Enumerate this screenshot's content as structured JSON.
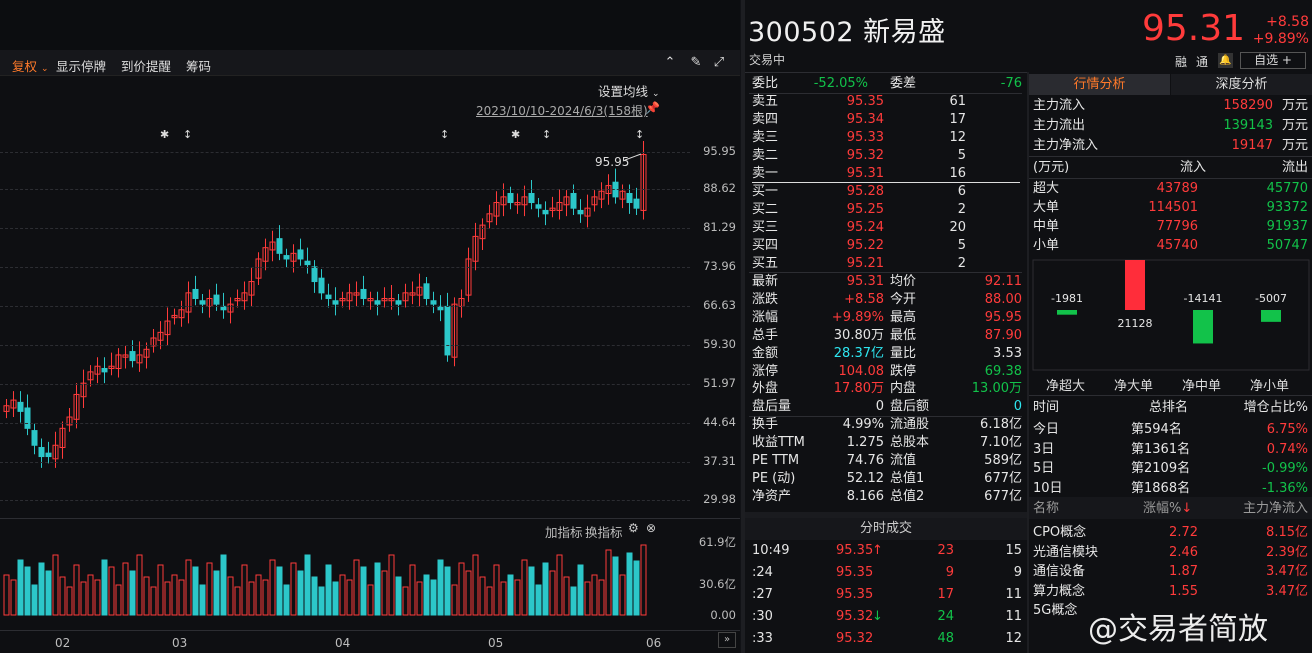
{
  "stock": {
    "code": "300502",
    "name": "新易盛",
    "status": "交易中",
    "price": "95.31",
    "change": "+8.58",
    "change_pct": "+9.89%",
    "btn_rong": "融",
    "btn_tong": "通",
    "btn_watch": "自选 +"
  },
  "toolbar": {
    "fq": "复权",
    "show_halt": "显示停牌",
    "alert": "到价提醒",
    "chips": "筹码",
    "set_ma": "设置均线",
    "range": "2023/10/10-2024/6/3(158根)",
    "peak_label": "95.95"
  },
  "y_labels": [
    "95.95",
    "88.62",
    "81.29",
    "73.96",
    "66.63",
    "59.30",
    "51.97",
    "44.64",
    "37.31",
    "29.98"
  ],
  "x_labels": [
    "02",
    "03",
    "04",
    "05",
    "06"
  ],
  "vol": {
    "add_indicator": "加指标",
    "switch_indicator": "换指标",
    "labels": [
      "61.9亿",
      "30.6亿",
      "0.00"
    ]
  },
  "orderbook": {
    "weibi_label": "委比",
    "weibi": "-52.05%",
    "weicha_label": "委差",
    "weicha": "-76",
    "asks": [
      {
        "label": "卖五",
        "price": "95.35",
        "vol": "61"
      },
      {
        "label": "卖四",
        "price": "95.34",
        "vol": "17"
      },
      {
        "label": "卖三",
        "price": "95.33",
        "vol": "12"
      },
      {
        "label": "卖二",
        "price": "95.32",
        "vol": "5"
      },
      {
        "label": "卖一",
        "price": "95.31",
        "vol": "16"
      }
    ],
    "bids": [
      {
        "label": "买一",
        "price": "95.28",
        "vol": "6"
      },
      {
        "label": "买二",
        "price": "95.25",
        "vol": "2"
      },
      {
        "label": "买三",
        "price": "95.24",
        "vol": "20"
      },
      {
        "label": "买四",
        "price": "95.22",
        "vol": "5"
      },
      {
        "label": "买五",
        "price": "95.21",
        "vol": "2"
      }
    ]
  },
  "quote": [
    {
      "l1": "最新",
      "v1": "95.31",
      "c1": "red",
      "l2": "均价",
      "v2": "92.11",
      "c2": "red"
    },
    {
      "l1": "涨跌",
      "v1": "+8.58",
      "c1": "red",
      "l2": "今开",
      "v2": "88.00",
      "c2": "red"
    },
    {
      "l1": "涨幅",
      "v1": "+9.89%",
      "c1": "red",
      "l2": "最高",
      "v2": "95.95",
      "c2": "red"
    },
    {
      "l1": "总手",
      "v1": "30.80万",
      "c1": "white",
      "l2": "最低",
      "v2": "87.90",
      "c2": "red"
    },
    {
      "l1": "金额",
      "v1": "28.37亿",
      "c1": "cyan",
      "l2": "量比",
      "v2": "3.53",
      "c2": "white"
    },
    {
      "l1": "涨停",
      "v1": "104.08",
      "c1": "red",
      "l2": "跌停",
      "v2": "69.38",
      "c2": "green"
    },
    {
      "l1": "外盘",
      "v1": "17.80万",
      "c1": "red",
      "l2": "内盘",
      "v2": "13.00万",
      "c2": "green"
    },
    {
      "l1": "盘后量",
      "v1": "0",
      "c1": "white",
      "l2": "盘后额",
      "v2": "0",
      "c2": "cyan"
    },
    {
      "l1": "换手",
      "v1": "4.99%",
      "c1": "white",
      "l2": "流通股",
      "v2": "6.18亿",
      "c2": "white"
    },
    {
      "l1": "收益TTM",
      "v1": "1.275",
      "c1": "white",
      "l2": "总股本",
      "v2": "7.10亿",
      "c2": "white"
    },
    {
      "l1": "PE TTM",
      "v1": "74.76",
      "c1": "white",
      "l2": "流值",
      "v2": "589亿",
      "c2": "white"
    },
    {
      "l1": "PE (动)",
      "v1": "52.12",
      "c1": "white",
      "l2": "总值1",
      "v2": "677亿",
      "c2": "white"
    },
    {
      "l1": "净资产",
      "v1": "8.166",
      "c1": "white",
      "l2": "总值2",
      "v2": "677亿",
      "c2": "white"
    }
  ],
  "ticks": {
    "title": "分时成交",
    "rows": [
      {
        "t": "10:49",
        "p": "95.35",
        "arrow": "up",
        "v": "23",
        "vc": "red",
        "n": "15"
      },
      {
        "t": ":24",
        "p": "95.35",
        "arrow": "",
        "v": "9",
        "vc": "red",
        "n": "9"
      },
      {
        "t": ":27",
        "p": "95.35",
        "arrow": "",
        "v": "17",
        "vc": "red",
        "n": "11"
      },
      {
        "t": ":30",
        "p": "95.32",
        "arrow": "down",
        "v": "24",
        "vc": "green",
        "n": "11"
      },
      {
        "t": ":33",
        "p": "95.32",
        "arrow": "",
        "v": "48",
        "vc": "green",
        "n": "12"
      }
    ]
  },
  "analysis": {
    "tab1": "行情分析",
    "tab2": "深度分析",
    "flows": [
      {
        "label": "主力流入",
        "value": "158290",
        "unit": "万元",
        "c": "red"
      },
      {
        "label": "主力流出",
        "value": "139143",
        "unit": "万元",
        "c": "green"
      },
      {
        "label": "主力净流入",
        "value": "19147",
        "unit": "万元",
        "c": "red"
      }
    ],
    "table_head": {
      "unit": "(万元)",
      "in": "流入",
      "out": "流出"
    },
    "table": [
      {
        "label": "超大",
        "in": "43789",
        "out": "45770"
      },
      {
        "label": "大单",
        "in": "114501",
        "out": "93372"
      },
      {
        "label": "中单",
        "in": "77796",
        "out": "91937"
      },
      {
        "label": "小单",
        "in": "45740",
        "out": "50747"
      }
    ],
    "net_labels": [
      "净超大",
      "净大单",
      "净中单",
      "净小单"
    ],
    "net_values": [
      -1981,
      21128,
      -14141,
      -5007
    ],
    "rank_head": {
      "time": "时间",
      "rank": "总排名",
      "ratio": "增仓占比%"
    },
    "ranks": [
      {
        "t": "今日",
        "r": "第594名",
        "v": "6.75%",
        "c": "red"
      },
      {
        "t": "3日",
        "r": "第1361名",
        "v": "0.74%",
        "c": "red"
      },
      {
        "t": "5日",
        "r": "第2109名",
        "v": "-0.99%",
        "c": "green"
      },
      {
        "t": "10日",
        "r": "第1868名",
        "v": "-1.36%",
        "c": "green"
      }
    ],
    "concept_head": {
      "name": "名称",
      "pct": "涨幅%",
      "flow": "主力净流入"
    },
    "concepts": [
      {
        "n": "CPO概念",
        "p": "2.72",
        "f": "8.15亿"
      },
      {
        "n": "光通信模块",
        "p": "2.46",
        "f": "2.39亿"
      },
      {
        "n": "通信设备",
        "p": "1.87",
        "f": "3.47亿"
      },
      {
        "n": "算力概念",
        "p": "1.55",
        "f": "3.47亿"
      },
      {
        "n": "5G概念",
        "p": "",
        "f": ""
      }
    ]
  },
  "watermark": "@交易者简放",
  "colors": {
    "up": "#ff3b3b",
    "down": "#2cc7c9",
    "green": "#12c24a",
    "cyan": "#2ee6f0"
  }
}
